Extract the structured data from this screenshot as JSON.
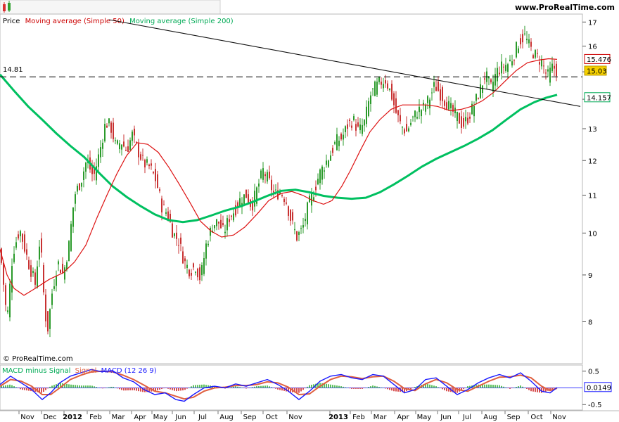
{
  "toolbar": {
    "icon": "candlestick-icon",
    "brand": "www.ProRealTime.com"
  },
  "chart_data": [
    {
      "type": "candlestick",
      "title_parts": [
        {
          "text": "Price",
          "color": "#000000"
        },
        {
          "text": "Moving average (Simple 50)",
          "color": "#cc0000"
        },
        {
          "text": "Moving average (Simple 200)",
          "color": "#00aa55"
        }
      ],
      "ylim": [
        7.5,
        17.1
      ],
      "yscale": "log",
      "yticks": [
        8,
        9,
        10,
        11,
        12,
        13,
        14,
        15,
        16,
        17
      ],
      "xlim": [
        0,
        825
      ],
      "x_labels": [
        "Nov",
        "Dec",
        "2012",
        "Feb",
        "Mar",
        "Apr",
        "May",
        "Jun",
        "Jul",
        "Aug",
        "Sep",
        "Oct",
        "Nov",
        "2013",
        "Feb",
        "Mar",
        "Apr",
        "May",
        "Jun",
        "Jul",
        "Aug",
        "Sep",
        "Oct",
        "Nov"
      ],
      "x_label_pos": [
        39,
        71,
        103,
        136,
        168,
        199,
        228,
        257,
        288,
        322,
        355,
        386,
        420,
        481,
        510,
        540,
        573,
        603,
        634,
        664,
        697,
        730,
        763,
        795
      ],
      "hline": {
        "value": 14.81,
        "label": "14.81"
      },
      "trendline": {
        "from": [
          155,
          17.1
        ],
        "to": [
          825,
          13.75
        ]
      },
      "current": {
        "price": 15.03,
        "sma50": 15.476,
        "sma200": 14.157
      },
      "price_path": [
        [
          0,
          9.6
        ],
        [
          10,
          8.0
        ],
        [
          18,
          9.5
        ],
        [
          28,
          10.1
        ],
        [
          40,
          9.3
        ],
        [
          50,
          8.8
        ],
        [
          57,
          9.9
        ],
        [
          62,
          8.6
        ],
        [
          67,
          7.75
        ],
        [
          74,
          8.6
        ],
        [
          82,
          9.3
        ],
        [
          90,
          9.0
        ],
        [
          98,
          9.7
        ],
        [
          106,
          11.0
        ],
        [
          115,
          11.4
        ],
        [
          123,
          12.0
        ],
        [
          133,
          11.5
        ],
        [
          142,
          12.3
        ],
        [
          150,
          13.2
        ],
        [
          157,
          13.1
        ],
        [
          165,
          12.4
        ],
        [
          172,
          12.6
        ],
        [
          180,
          12.3
        ],
        [
          188,
          12.8
        ],
        [
          196,
          12.3
        ],
        [
          205,
          11.9
        ],
        [
          213,
          11.8
        ],
        [
          222,
          11.4
        ],
        [
          230,
          10.7
        ],
        [
          238,
          10.5
        ],
        [
          246,
          10.0
        ],
        [
          254,
          9.8
        ],
        [
          262,
          9.3
        ],
        [
          270,
          9.1
        ],
        [
          278,
          9.2
        ],
        [
          285,
          8.9
        ],
        [
          293,
          9.7
        ],
        [
          302,
          10.2
        ],
        [
          310,
          10.3
        ],
        [
          318,
          10.0
        ],
        [
          326,
          10.4
        ],
        [
          334,
          10.6
        ],
        [
          342,
          10.9
        ],
        [
          350,
          11.0
        ],
        [
          358,
          10.7
        ],
        [
          366,
          11.2
        ],
        [
          374,
          11.7
        ],
        [
          382,
          11.4
        ],
        [
          390,
          11.0
        ],
        [
          398,
          11.1
        ],
        [
          406,
          10.9
        ],
        [
          414,
          10.3
        ],
        [
          422,
          9.9
        ],
        [
          430,
          10.1
        ],
        [
          438,
          10.7
        ],
        [
          446,
          11.1
        ],
        [
          454,
          11.6
        ],
        [
          462,
          11.9
        ],
        [
          470,
          12.2
        ],
        [
          478,
          12.6
        ],
        [
          486,
          12.7
        ],
        [
          494,
          13.1
        ],
        [
          502,
          13.3
        ],
        [
          510,
          12.9
        ],
        [
          518,
          13.2
        ],
        [
          526,
          14.1
        ],
        [
          533,
          14.4
        ],
        [
          540,
          14.6
        ],
        [
          548,
          14.7
        ],
        [
          556,
          14.2
        ],
        [
          562,
          13.6
        ],
        [
          570,
          13.1
        ],
        [
          578,
          12.9
        ],
        [
          586,
          13.3
        ],
        [
          594,
          13.6
        ],
        [
          602,
          13.7
        ],
        [
          610,
          14.0
        ],
        [
          618,
          14.5
        ],
        [
          626,
          14.2
        ],
        [
          634,
          13.9
        ],
        [
          642,
          13.6
        ],
        [
          650,
          13.4
        ],
        [
          658,
          13.1
        ],
        [
          666,
          13.4
        ],
        [
          674,
          13.8
        ],
        [
          682,
          14.3
        ],
        [
          690,
          14.9
        ],
        [
          698,
          14.4
        ],
        [
          706,
          15.0
        ],
        [
          714,
          15.2
        ],
        [
          722,
          15.3
        ],
        [
          730,
          15.6
        ],
        [
          738,
          16.2
        ],
        [
          746,
          16.4
        ],
        [
          754,
          15.9
        ],
        [
          762,
          15.6
        ],
        [
          770,
          15.4
        ],
        [
          778,
          14.8
        ],
        [
          786,
          15.2
        ],
        [
          792,
          15.03
        ]
      ],
      "sma50_path": [
        [
          0,
          9.6
        ],
        [
          10,
          9.0
        ],
        [
          20,
          8.7
        ],
        [
          34,
          8.55
        ],
        [
          50,
          8.7
        ],
        [
          70,
          8.9
        ],
        [
          90,
          9.05
        ],
        [
          106,
          9.3
        ],
        [
          122,
          9.7
        ],
        [
          138,
          10.4
        ],
        [
          152,
          11.0
        ],
        [
          166,
          11.6
        ],
        [
          180,
          12.15
        ],
        [
          195,
          12.55
        ],
        [
          210,
          12.5
        ],
        [
          225,
          12.25
        ],
        [
          240,
          11.8
        ],
        [
          255,
          11.3
        ],
        [
          270,
          10.8
        ],
        [
          285,
          10.3
        ],
        [
          300,
          10.05
        ],
        [
          315,
          9.9
        ],
        [
          332,
          9.95
        ],
        [
          348,
          10.15
        ],
        [
          366,
          10.5
        ],
        [
          382,
          10.85
        ],
        [
          400,
          11.05
        ],
        [
          415,
          11.1
        ],
        [
          430,
          11.0
        ],
        [
          445,
          10.85
        ],
        [
          460,
          10.75
        ],
        [
          472,
          10.85
        ],
        [
          486,
          11.25
        ],
        [
          498,
          11.7
        ],
        [
          512,
          12.3
        ],
        [
          526,
          12.9
        ],
        [
          540,
          13.3
        ],
        [
          556,
          13.65
        ],
        [
          572,
          13.8
        ],
        [
          590,
          13.8
        ],
        [
          606,
          13.8
        ],
        [
          622,
          13.75
        ],
        [
          640,
          13.6
        ],
        [
          656,
          13.65
        ],
        [
          670,
          13.75
        ],
        [
          686,
          13.95
        ],
        [
          702,
          14.25
        ],
        [
          718,
          14.65
        ],
        [
          734,
          15.05
        ],
        [
          750,
          15.35
        ],
        [
          766,
          15.45
        ],
        [
          780,
          15.5
        ],
        [
          792,
          15.476
        ]
      ],
      "sma200_path": [
        [
          0,
          14.9
        ],
        [
          20,
          14.3
        ],
        [
          40,
          13.75
        ],
        [
          60,
          13.3
        ],
        [
          80,
          12.85
        ],
        [
          100,
          12.45
        ],
        [
          120,
          12.1
        ],
        [
          140,
          11.65
        ],
        [
          160,
          11.25
        ],
        [
          180,
          10.95
        ],
        [
          200,
          10.7
        ],
        [
          220,
          10.48
        ],
        [
          240,
          10.33
        ],
        [
          260,
          10.28
        ],
        [
          280,
          10.33
        ],
        [
          300,
          10.45
        ],
        [
          320,
          10.58
        ],
        [
          340,
          10.68
        ],
        [
          360,
          10.82
        ],
        [
          380,
          10.98
        ],
        [
          400,
          11.12
        ],
        [
          420,
          11.15
        ],
        [
          440,
          11.08
        ],
        [
          460,
          10.98
        ],
        [
          480,
          10.93
        ],
        [
          500,
          10.9
        ],
        [
          520,
          10.93
        ],
        [
          540,
          11.08
        ],
        [
          560,
          11.3
        ],
        [
          580,
          11.55
        ],
        [
          600,
          11.82
        ],
        [
          620,
          12.05
        ],
        [
          640,
          12.25
        ],
        [
          660,
          12.45
        ],
        [
          680,
          12.68
        ],
        [
          700,
          12.95
        ],
        [
          720,
          13.3
        ],
        [
          740,
          13.65
        ],
        [
          760,
          13.9
        ],
        [
          776,
          14.05
        ],
        [
          792,
          14.157
        ]
      ]
    },
    {
      "type": "macd",
      "title_parts": [
        {
          "text": "MACD minus Signal",
          "color": "#00aa55"
        },
        {
          "text": "Signal",
          "color": "#e06040"
        },
        {
          "text": "MACD (12 26 9)",
          "color": "#1a1aff"
        }
      ],
      "ylim": [
        -0.6,
        0.62
      ],
      "yticks": [
        0.5,
        -0.5
      ],
      "current": {
        "value": 0.0149
      },
      "macd_path": [
        [
          0,
          0.1
        ],
        [
          15,
          0.35
        ],
        [
          30,
          0.15
        ],
        [
          45,
          -0.05
        ],
        [
          60,
          -0.35
        ],
        [
          72,
          -0.15
        ],
        [
          85,
          0.15
        ],
        [
          100,
          0.35
        ],
        [
          115,
          0.45
        ],
        [
          130,
          0.55
        ],
        [
          145,
          0.48
        ],
        [
          160,
          0.52
        ],
        [
          175,
          0.3
        ],
        [
          190,
          0.18
        ],
        [
          205,
          -0.05
        ],
        [
          220,
          -0.2
        ],
        [
          235,
          -0.15
        ],
        [
          250,
          -0.35
        ],
        [
          262,
          -0.4
        ],
        [
          275,
          -0.2
        ],
        [
          290,
          0.0
        ],
        [
          305,
          0.05
        ],
        [
          320,
          0.0
        ],
        [
          335,
          0.12
        ],
        [
          350,
          0.05
        ],
        [
          365,
          0.15
        ],
        [
          380,
          0.25
        ],
        [
          395,
          0.1
        ],
        [
          410,
          -0.1
        ],
        [
          425,
          -0.35
        ],
        [
          440,
          -0.1
        ],
        [
          455,
          0.2
        ],
        [
          470,
          0.35
        ],
        [
          485,
          0.4
        ],
        [
          500,
          0.3
        ],
        [
          515,
          0.25
        ],
        [
          530,
          0.4
        ],
        [
          545,
          0.35
        ],
        [
          560,
          0.1
        ],
        [
          575,
          -0.15
        ],
        [
          590,
          -0.05
        ],
        [
          605,
          0.25
        ],
        [
          620,
          0.3
        ],
        [
          635,
          0.05
        ],
        [
          650,
          -0.2
        ],
        [
          665,
          -0.05
        ],
        [
          680,
          0.15
        ],
        [
          695,
          0.3
        ],
        [
          710,
          0.4
        ],
        [
          725,
          0.3
        ],
        [
          740,
          0.45
        ],
        [
          755,
          0.2
        ],
        [
          770,
          -0.1
        ],
        [
          782,
          -0.15
        ],
        [
          792,
          0.01
        ]
      ],
      "signal_path": [
        [
          0,
          0.05
        ],
        [
          15,
          0.25
        ],
        [
          30,
          0.2
        ],
        [
          45,
          0.05
        ],
        [
          60,
          -0.2
        ],
        [
          72,
          -0.2
        ],
        [
          85,
          0.0
        ],
        [
          100,
          0.25
        ],
        [
          115,
          0.38
        ],
        [
          130,
          0.48
        ],
        [
          145,
          0.5
        ],
        [
          160,
          0.48
        ],
        [
          175,
          0.38
        ],
        [
          190,
          0.25
        ],
        [
          205,
          0.08
        ],
        [
          220,
          -0.1
        ],
        [
          235,
          -0.15
        ],
        [
          250,
          -0.25
        ],
        [
          262,
          -0.33
        ],
        [
          275,
          -0.28
        ],
        [
          290,
          -0.1
        ],
        [
          305,
          0.0
        ],
        [
          320,
          0.02
        ],
        [
          335,
          0.07
        ],
        [
          350,
          0.07
        ],
        [
          365,
          0.1
        ],
        [
          380,
          0.18
        ],
        [
          395,
          0.15
        ],
        [
          410,
          0.02
        ],
        [
          425,
          -0.2
        ],
        [
          440,
          -0.18
        ],
        [
          455,
          0.05
        ],
        [
          470,
          0.25
        ],
        [
          485,
          0.35
        ],
        [
          500,
          0.33
        ],
        [
          515,
          0.28
        ],
        [
          530,
          0.33
        ],
        [
          545,
          0.35
        ],
        [
          560,
          0.2
        ],
        [
          575,
          -0.02
        ],
        [
          590,
          -0.08
        ],
        [
          605,
          0.12
        ],
        [
          620,
          0.25
        ],
        [
          635,
          0.15
        ],
        [
          650,
          -0.05
        ],
        [
          665,
          -0.1
        ],
        [
          680,
          0.05
        ],
        [
          695,
          0.2
        ],
        [
          710,
          0.32
        ],
        [
          725,
          0.33
        ],
        [
          740,
          0.38
        ],
        [
          755,
          0.3
        ],
        [
          770,
          0.05
        ],
        [
          782,
          -0.08
        ],
        [
          792,
          -0.01
        ]
      ]
    }
  ],
  "footer": {
    "copyright": "© ProRealTime.com"
  }
}
